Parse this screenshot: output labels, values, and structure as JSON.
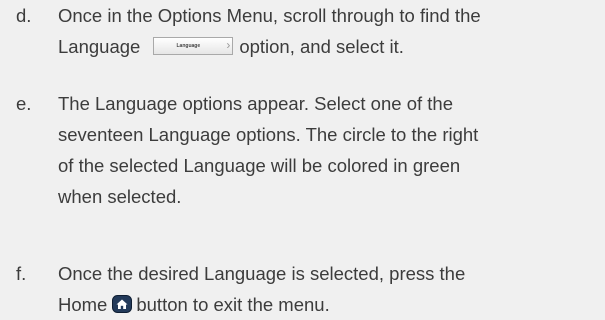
{
  "steps": [
    {
      "letter": "d.",
      "line1": "Once in the Options Menu, scroll through to find the",
      "line2_before": "Language",
      "line2_after": "option, and select it."
    },
    {
      "letter": "e.",
      "lines": [
        "The Language options appear. Select one of the",
        "seventeen Language options.  The circle to the right",
        "of the selected Language will be colored in green",
        "when selected."
      ]
    },
    {
      "letter": "f.",
      "line1": "Once the desired Language is selected, press the",
      "line2_before": "Home",
      "line2_after": "button to exit the menu."
    }
  ],
  "language_option": {
    "label": "Language",
    "chevron": "›"
  },
  "icons": {
    "home": "home-icon"
  },
  "colors": {
    "background": "#f0f0f0",
    "text": "#3c3c3c",
    "home_icon": "#233a5a"
  }
}
